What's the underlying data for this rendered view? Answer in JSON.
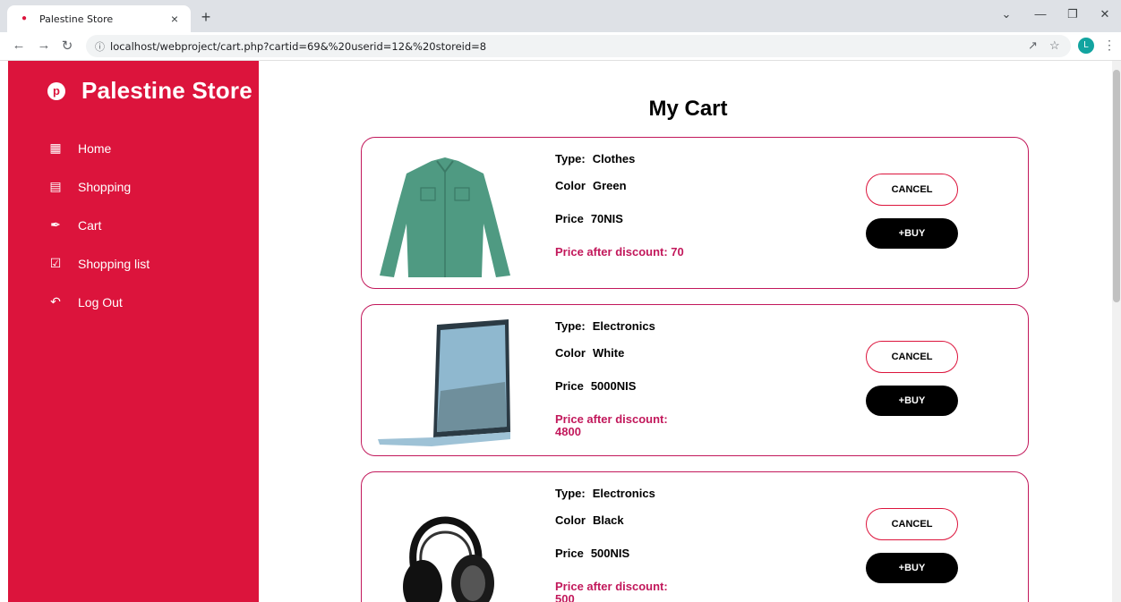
{
  "browser": {
    "tab_title": "Palestine Store",
    "tab_close": "×",
    "new_tab": "+",
    "url": "localhost/webproject/cart.php?cartid=69&%20userid=12&%20storeid=8",
    "profile_initial": "L"
  },
  "sidebar": {
    "brand": "Palestine Store",
    "items": [
      {
        "label": "Home",
        "icon": "grid-icon"
      },
      {
        "label": "Shopping",
        "icon": "store-icon"
      },
      {
        "label": "Cart",
        "icon": "cart-icon"
      },
      {
        "label": "Shopping list",
        "icon": "bag-icon"
      },
      {
        "label": "Log Out",
        "icon": "logout-icon"
      }
    ]
  },
  "main": {
    "title": "My Cart",
    "items": [
      {
        "image": "green-shirt",
        "type_label": "Type:",
        "type": "Clothes",
        "color_label": "Color",
        "color": "Green",
        "price_label": "Price",
        "price": "70NIS",
        "discount_text": "Price after discount: 70",
        "cancel_label": "CANCEL",
        "buy_label": "BUY",
        "buy_prefix": "+"
      },
      {
        "image": "laptop",
        "type_label": "Type:",
        "type": "Electronics",
        "color_label": "Color",
        "color": "White",
        "price_label": "Price",
        "price": "5000NIS",
        "discount_text": "Price after discount: 4800",
        "cancel_label": "CANCEL",
        "buy_label": "BUY",
        "buy_prefix": "+"
      },
      {
        "image": "headphones",
        "type_label": "Type:",
        "type": "Electronics",
        "color_label": "Color",
        "color": "Black",
        "price_label": "Price",
        "price": "500NIS",
        "discount_text": "Price after discount: 500",
        "cancel_label": "CANCEL",
        "buy_label": "BUY",
        "buy_prefix": "+"
      }
    ]
  },
  "colors": {
    "brand": "#dc143c",
    "card_border": "#c2185b",
    "discount": "#c2185b"
  }
}
